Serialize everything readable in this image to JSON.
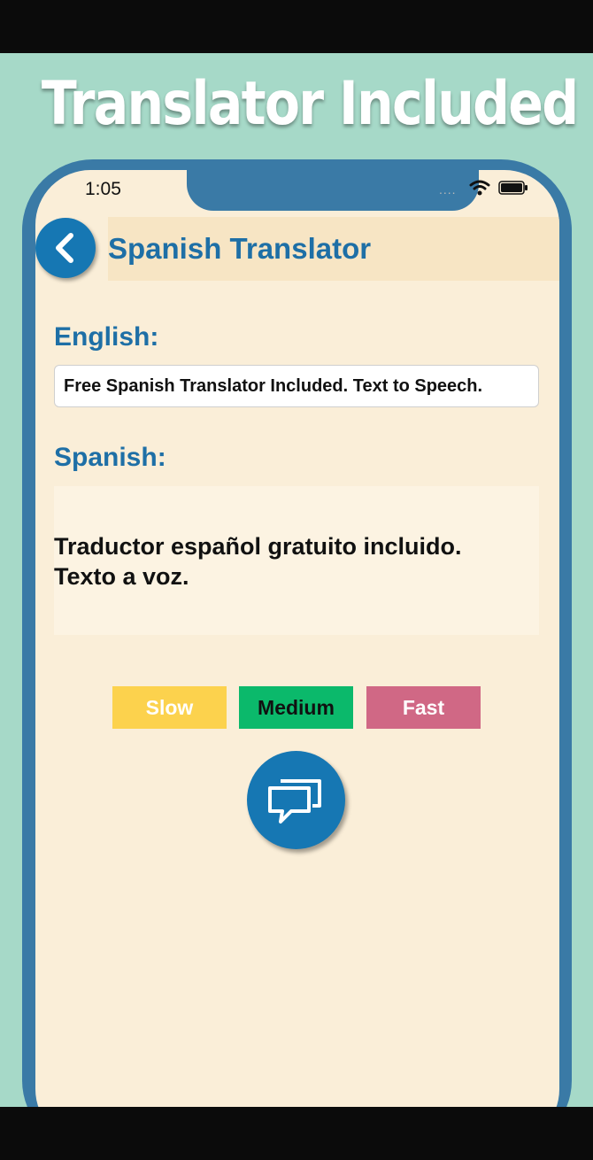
{
  "promo": {
    "headline": "Translator Included"
  },
  "status_bar": {
    "time": "1:05",
    "signal": "....",
    "icons": [
      "wifi-icon",
      "battery-icon"
    ]
  },
  "header": {
    "title": "Spanish Translator",
    "back_icon": "chevron-left-icon"
  },
  "source": {
    "label": "English:",
    "value": "Free Spanish Translator Included. Text to Speech."
  },
  "target": {
    "label": "Spanish:",
    "line1": "Traductor español gratuito incluido.",
    "line2": "Texto a voz."
  },
  "speed_buttons": {
    "slow": "Slow",
    "medium": "Medium",
    "fast": "Fast"
  },
  "speak_button": {
    "icon": "speech-bubbles-icon"
  },
  "colors": {
    "primary_blue": "#1677b3",
    "title_blue": "#1e6fa6",
    "phone_frame": "#3a7aa6",
    "screen_bg": "#faeed8",
    "promo_bg": "#a6d9c8",
    "slow": "#fcd24d",
    "medium": "#0bb96b",
    "fast": "#d06885"
  }
}
